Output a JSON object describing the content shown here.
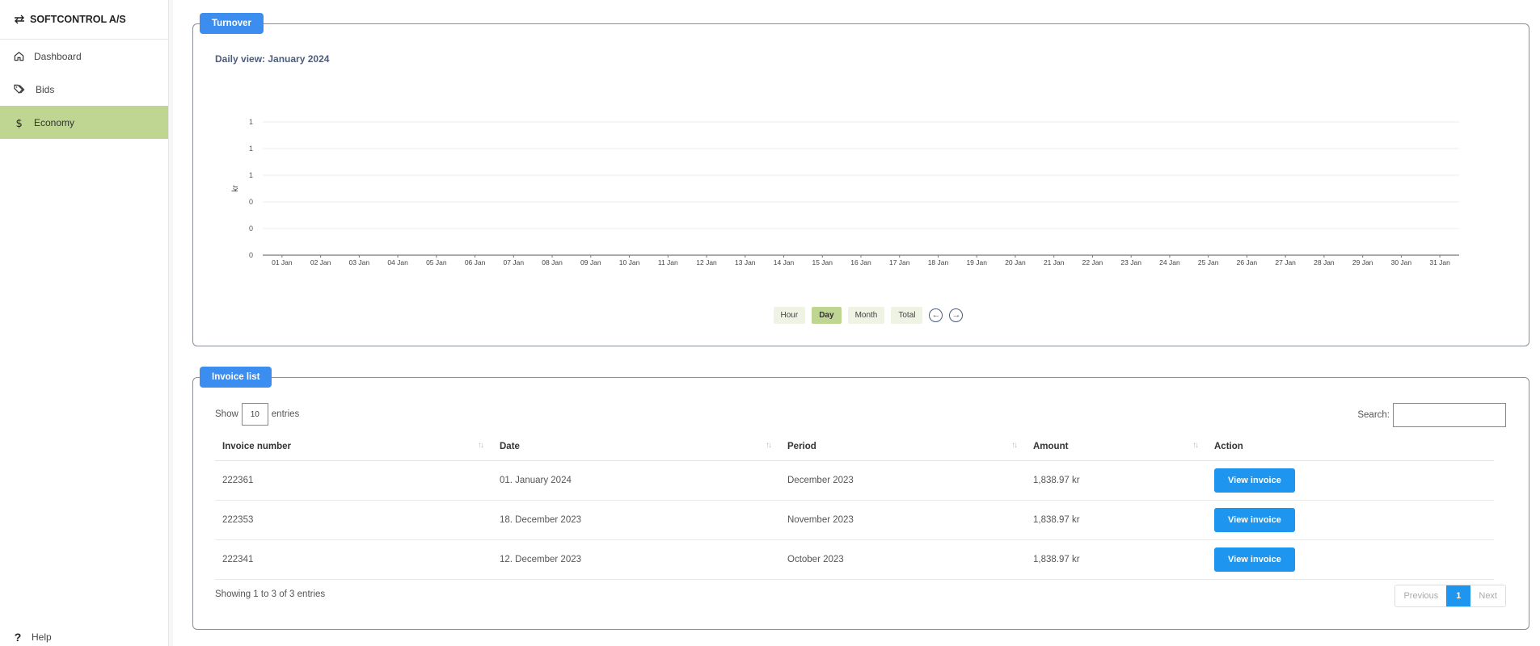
{
  "brand": {
    "name": "SOFTCONTROL A/S"
  },
  "sidebar": {
    "items": [
      {
        "label": "Dashboard",
        "icon": "home-icon"
      },
      {
        "label": "Bids",
        "icon": "tags-icon"
      },
      {
        "label": "Economy",
        "icon": "dollar-icon",
        "active": true
      }
    ],
    "help_label": "Help"
  },
  "turnover": {
    "tag": "Turnover",
    "subtitle": "Daily view: January 2024",
    "buttons": [
      {
        "label": "Hour"
      },
      {
        "label": "Day",
        "active": true
      },
      {
        "label": "Month"
      },
      {
        "label": "Total"
      }
    ]
  },
  "chart_data": {
    "type": "line",
    "title": "",
    "ylabel": "kr",
    "xlabel": "",
    "y_tick_labels": [
      "1",
      "1",
      "1",
      "0",
      "0",
      "0"
    ],
    "categories": [
      "01 Jan",
      "02 Jan",
      "03 Jan",
      "04 Jan",
      "05 Jan",
      "06 Jan",
      "07 Jan",
      "08 Jan",
      "09 Jan",
      "10 Jan",
      "11 Jan",
      "12 Jan",
      "13 Jan",
      "14 Jan",
      "15 Jan",
      "16 Jan",
      "17 Jan",
      "18 Jan",
      "19 Jan",
      "20 Jan",
      "21 Jan",
      "22 Jan",
      "23 Jan",
      "24 Jan",
      "25 Jan",
      "26 Jan",
      "27 Jan",
      "28 Jan",
      "29 Jan",
      "30 Jan",
      "31 Jan"
    ],
    "series": [],
    "grid": true
  },
  "invoices": {
    "tag": "Invoice list",
    "show_label": "Show",
    "entries_value": "10",
    "entries_label": "entries",
    "search_label": "Search:",
    "columns": [
      "Invoice number",
      "Date",
      "Period",
      "Amount",
      "Action"
    ],
    "rows": [
      {
        "number": "222361",
        "date": "01. January 2024",
        "period": "December 2023",
        "amount": "1,838.97 kr",
        "action": "View invoice"
      },
      {
        "number": "222353",
        "date": "18. December 2023",
        "period": "November 2023",
        "amount": "1,838.97 kr",
        "action": "View invoice"
      },
      {
        "number": "222341",
        "date": "12. December 2023",
        "period": "October 2023",
        "amount": "1,838.97 kr",
        "action": "View invoice"
      }
    ],
    "showing_text": "Showing 1 to 3 of 3 entries",
    "pager": {
      "previous": "Previous",
      "current": "1",
      "next": "Next"
    }
  }
}
